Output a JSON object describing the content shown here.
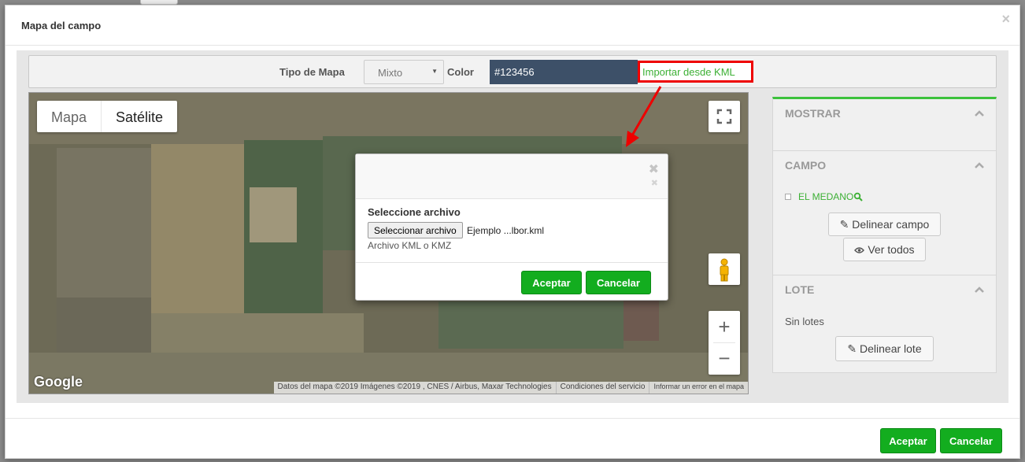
{
  "modal": {
    "title": "Mapa del campo",
    "close_glyph": "×"
  },
  "toolbar": {
    "map_type_label": "Tipo de Mapa",
    "map_type_value": "Mixto",
    "color_label": "Color",
    "color_value": "#123456",
    "import_label": "Importar desde KML"
  },
  "map": {
    "type_map": "Mapa",
    "type_satellite": "Satélite",
    "google_logo": "Google",
    "attribution": "Datos del mapa ©2019 Imágenes ©2019 , CNES / Airbus, Maxar Technologies",
    "terms": "Condiciones del servicio",
    "report": "Informar un error en el mapa",
    "icons": {
      "fullscreen": "fullscreen-icon",
      "pegman": "pegman-icon",
      "zoom_in": "+",
      "zoom_out": "−"
    }
  },
  "dialog": {
    "section_title": "Seleccione archivo",
    "file_button": "Seleccionar archivo",
    "file_name": "Ejemplo ...lbor.kml",
    "hint": "Archivo KML o KMZ",
    "accept": "Aceptar",
    "cancel": "Cancelar"
  },
  "side": {
    "mostrar_title": "MOSTRAR",
    "campo_title": "CAMPO",
    "campo_item": "EL MEDANO",
    "delinear_campo": "Delinear campo",
    "ver_todos": "Ver todos",
    "lote_title": "LOTE",
    "sin_lotes": "Sin lotes",
    "delinear_lote": "Delinear lote"
  },
  "footer": {
    "accept": "Aceptar",
    "cancel": "Cancelar"
  },
  "colors": {
    "green_button": "#13ad1f",
    "green_link": "#3cb034",
    "highlight_border": "#ee0000",
    "color_swatch": "#3d5068"
  }
}
